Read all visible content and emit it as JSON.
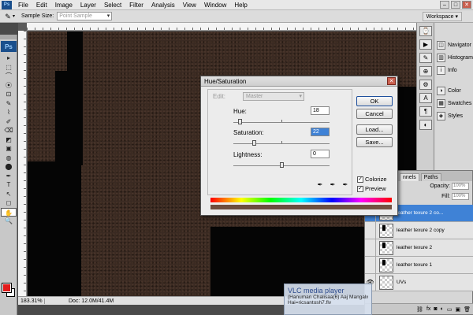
{
  "menubar": {
    "logo": "Ps",
    "items": [
      "File",
      "Edit",
      "Image",
      "Layer",
      "Select",
      "Filter",
      "Analysis",
      "View",
      "Window",
      "Help"
    ]
  },
  "options_bar": {
    "tool_icon": "eyedropper-icon",
    "sample_size_label": "Sample Size:",
    "sample_size_value": "Point Sample",
    "workspace_label": "Workspace ▾"
  },
  "toolbox": {
    "logo": "Ps",
    "tools": [
      "▸",
      "⬚",
      "⌒",
      "⦿",
      "⊡",
      "✎",
      "⌇",
      "✐",
      "⌫",
      "◩",
      "▣",
      "◍",
      "⬤",
      "✒",
      "T",
      "↖",
      "◻",
      "✋",
      "🔍"
    ],
    "foreground_color": "#e31b1b",
    "background_color": "#ffffff"
  },
  "document": {
    "zoom": "183.31%",
    "doc_size": "Doc: 12.0M/41.4M"
  },
  "dock": {
    "panels": [
      {
        "label": "Navigator",
        "icon": "navigator-icon"
      },
      {
        "label": "Histogram",
        "icon": "histogram-icon"
      },
      {
        "label": "Info",
        "icon": "info-icon"
      },
      {
        "label": "Color",
        "icon": "color-icon"
      },
      {
        "label": "Swatches",
        "icon": "swatches-icon"
      },
      {
        "label": "Styles",
        "icon": "styles-icon"
      }
    ]
  },
  "layers_panel": {
    "tabs": [
      "nnels",
      "Paths"
    ],
    "opacity_label": "Opacity:",
    "opacity_value": "100%",
    "fill_label": "Fill:",
    "fill_value": "100%",
    "layers": [
      {
        "name": "leather texure 2 co...",
        "selected": true
      },
      {
        "name": "leather texure 2 copy",
        "selected": false
      },
      {
        "name": "leather texure 2",
        "selected": false
      },
      {
        "name": "leather texure 1",
        "selected": false
      },
      {
        "name": "UVs",
        "selected": false
      }
    ]
  },
  "hue_saturation": {
    "title": "Hue/Saturation",
    "edit_label": "Edit:",
    "edit_value": "Master",
    "hue_label": "Hue:",
    "hue_value": "18",
    "saturation_label": "Saturation:",
    "saturation_value": "22",
    "lightness_label": "Lightness:",
    "lightness_value": "0",
    "ok_label": "OK",
    "cancel_label": "Cancel",
    "load_label": "Load...",
    "save_label": "Save...",
    "colorize_label": "Colorize",
    "colorize_checked": true,
    "preview_label": "Preview",
    "preview_checked": true
  },
  "vlc_popup": {
    "title": "VLC media player",
    "line1": "(Hanuman Chalisaa(6) Aaj Mangalwar...",
    "line2": "Hai=ricsantosh7.flv"
  }
}
